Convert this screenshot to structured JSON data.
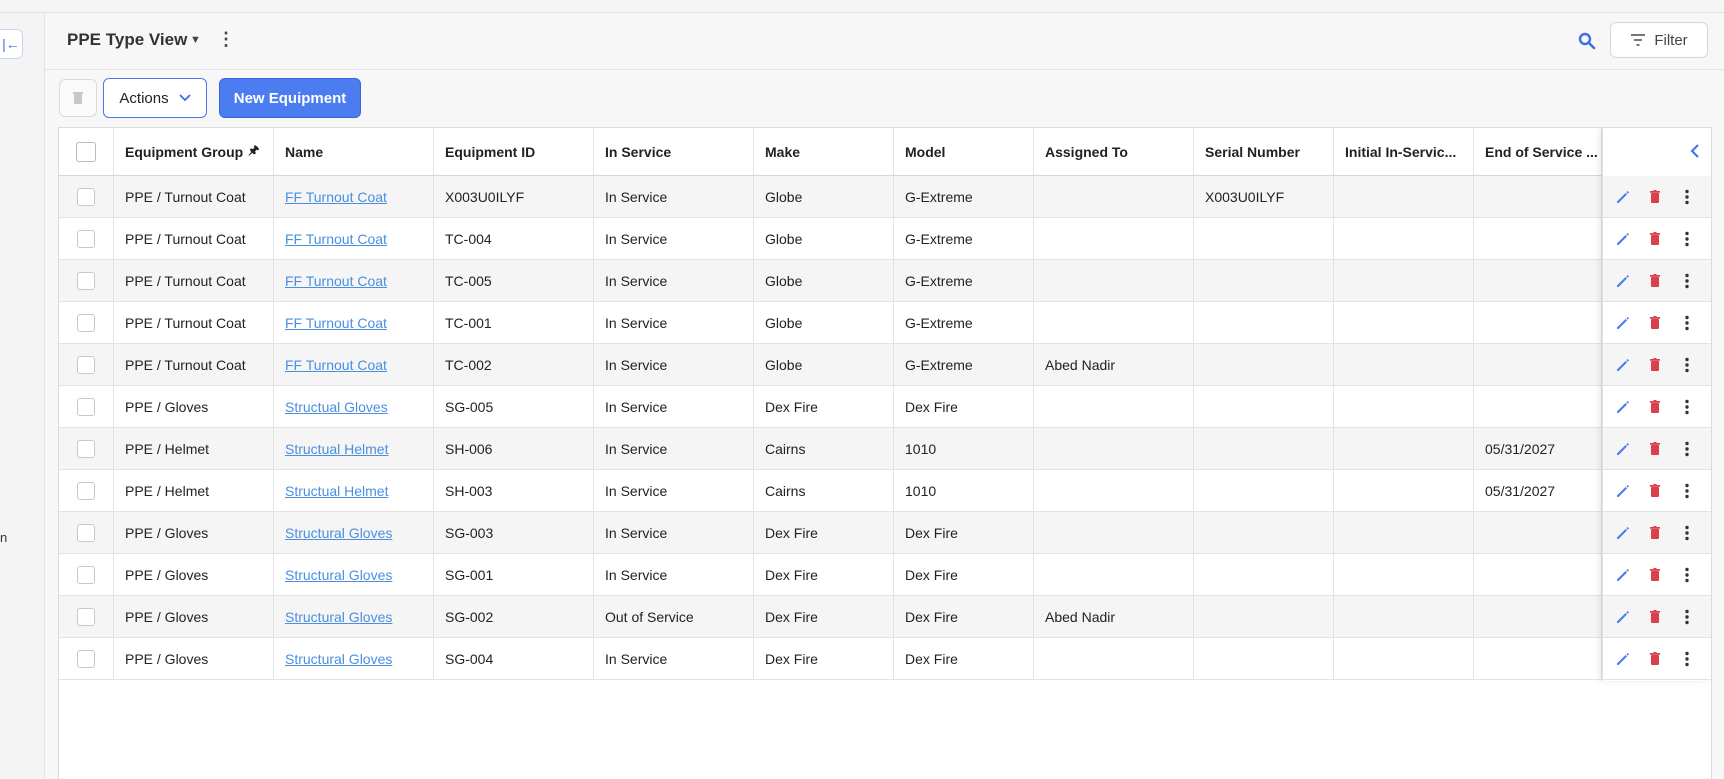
{
  "header": {
    "title": "PPE Type View",
    "filter_label": "Filter"
  },
  "toolbar": {
    "actions_label": "Actions",
    "new_label": "New Equipment"
  },
  "sidebar": {
    "partial_text": "n"
  },
  "table": {
    "columns": [
      "Equipment Group",
      "Name",
      "Equipment ID",
      "In Service",
      "Make",
      "Model",
      "Assigned To",
      "Serial Number",
      "Initial In-Servic...",
      "End of Service ..."
    ],
    "rows": [
      {
        "group": "PPE / Turnout Coat",
        "name": "FF Turnout Coat",
        "id": "X003U0ILYF",
        "status": "In Service",
        "make": "Globe",
        "model": "G-Extreme",
        "assigned": "",
        "serial": "X003U0ILYF",
        "initial": "",
        "end": ""
      },
      {
        "group": "PPE / Turnout Coat",
        "name": "FF Turnout Coat",
        "id": "TC-004",
        "status": "In Service",
        "make": "Globe",
        "model": "G-Extreme",
        "assigned": "",
        "serial": "",
        "initial": "",
        "end": ""
      },
      {
        "group": "PPE / Turnout Coat",
        "name": "FF Turnout Coat",
        "id": "TC-005",
        "status": "In Service",
        "make": "Globe",
        "model": "G-Extreme",
        "assigned": "",
        "serial": "",
        "initial": "",
        "end": ""
      },
      {
        "group": "PPE / Turnout Coat",
        "name": "FF Turnout Coat",
        "id": "TC-001",
        "status": "In Service",
        "make": "Globe",
        "model": "G-Extreme",
        "assigned": "",
        "serial": "",
        "initial": "",
        "end": ""
      },
      {
        "group": "PPE / Turnout Coat",
        "name": "FF Turnout Coat",
        "id": "TC-002",
        "status": "In Service",
        "make": "Globe",
        "model": "G-Extreme",
        "assigned": "Abed Nadir",
        "serial": "",
        "initial": "",
        "end": ""
      },
      {
        "group": "PPE / Gloves",
        "name": "Structual Gloves",
        "id": "SG-005",
        "status": "In Service",
        "make": "Dex Fire",
        "model": "Dex Fire",
        "assigned": "",
        "serial": "",
        "initial": "",
        "end": ""
      },
      {
        "group": "PPE / Helmet",
        "name": "Structual Helmet",
        "id": "SH-006",
        "status": "In Service",
        "make": "Cairns",
        "model": "1010",
        "assigned": "",
        "serial": "",
        "initial": "",
        "end": "05/31/2027"
      },
      {
        "group": "PPE / Helmet",
        "name": "Structual Helmet",
        "id": "SH-003",
        "status": "In Service",
        "make": "Cairns",
        "model": "1010",
        "assigned": "",
        "serial": "",
        "initial": "",
        "end": "05/31/2027"
      },
      {
        "group": "PPE / Gloves",
        "name": "Structural Gloves",
        "id": "SG-003",
        "status": "In Service",
        "make": "Dex Fire",
        "model": "Dex Fire",
        "assigned": "",
        "serial": "",
        "initial": "",
        "end": ""
      },
      {
        "group": "PPE / Gloves",
        "name": "Structural Gloves",
        "id": "SG-001",
        "status": "In Service",
        "make": "Dex Fire",
        "model": "Dex Fire",
        "assigned": "",
        "serial": "",
        "initial": "",
        "end": ""
      },
      {
        "group": "PPE / Gloves",
        "name": "Structural Gloves",
        "id": "SG-002",
        "status": "Out of Service",
        "make": "Dex Fire",
        "model": "Dex Fire",
        "assigned": "Abed Nadir",
        "serial": "",
        "initial": "",
        "end": ""
      },
      {
        "group": "PPE / Gloves",
        "name": "Structural Gloves",
        "id": "SG-004",
        "status": "In Service",
        "make": "Dex Fire",
        "model": "Dex Fire",
        "assigned": "",
        "serial": "",
        "initial": "",
        "end": ""
      }
    ]
  },
  "colors": {
    "accent": "#4b7cf0",
    "link": "#4a8fe0",
    "delete": "#d9404b"
  },
  "icons": [
    "collapse-sidebar-icon",
    "caret-down-icon",
    "kebab-icon",
    "search-icon",
    "filter-icon",
    "trash-icon",
    "chevron-down-icon",
    "pin-icon",
    "edit-icon",
    "chevron-left-icon"
  ]
}
